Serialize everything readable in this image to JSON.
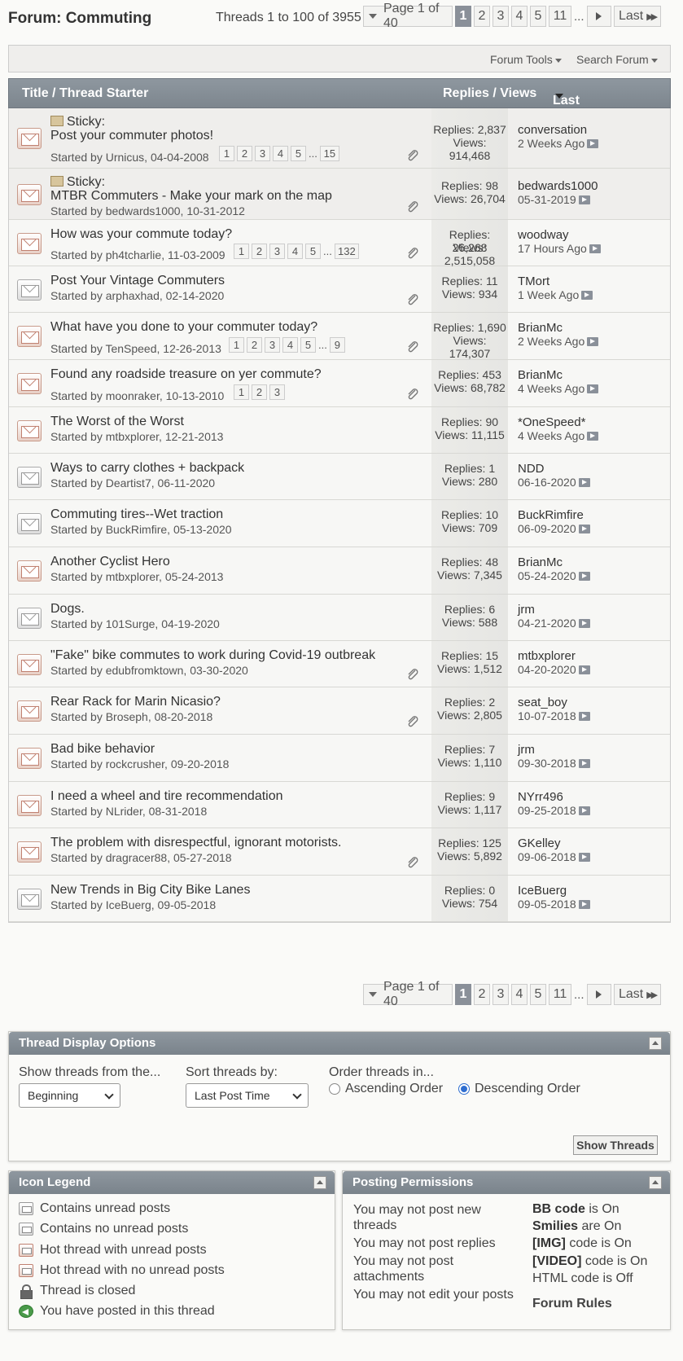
{
  "forum_title": "Forum: Commuting",
  "threads_count": "Threads 1 to 100 of 3955",
  "pager": {
    "page_label": "Page 1 of 40",
    "pages": [
      "1",
      "2",
      "3",
      "4",
      "5",
      "11"
    ],
    "ellipsis": "...",
    "last_label": "Last"
  },
  "toolbar": {
    "forum_tools": "Forum Tools",
    "search_forum": "Search Forum"
  },
  "table_header": {
    "title": "Title / Thread Starter",
    "replies_views": "Replies / Views",
    "last_post": "Last Post By"
  },
  "threads": [
    {
      "sticky": "Sticky:",
      "title": "Post your commuter photos!",
      "starter": "Started by Urnicus, 04-04-2008",
      "pages": [
        "1",
        "2",
        "3",
        "4",
        "5"
      ],
      "last_page": "15",
      "replies": "Replies: 2,837",
      "views": "Views: 914,468",
      "last_user": "conversation",
      "last_date": "2 Weeks Ago",
      "attach": true,
      "hot": true
    },
    {
      "sticky": "Sticky:",
      "title": "MTBR Commuters - Make your mark on the map",
      "starter": "Started by bedwards1000, 10-31-2012",
      "pages": [],
      "last_page": "",
      "replies": "Replies: 98",
      "views": "Views: 26,704",
      "last_user": "bedwards1000",
      "last_date": "05-31-2019",
      "attach": true,
      "hot": true
    },
    {
      "sticky": "",
      "title": "How was your commute today?",
      "starter": "Started by ph4tcharlie, 11-03-2009",
      "pages": [
        "1",
        "2",
        "3",
        "4",
        "5"
      ],
      "last_page": "132",
      "replies": "Replies: 26,268",
      "views": "Views: 2,515,058",
      "last_user": "woodway",
      "last_date": "17 Hours Ago",
      "attach": true,
      "hot": true
    },
    {
      "sticky": "",
      "title": "Post Your Vintage Commuters",
      "starter": "Started by arphaxhad, 02-14-2020",
      "pages": [],
      "last_page": "",
      "replies": "Replies: 11",
      "views": "Views: 934",
      "last_user": "TMort",
      "last_date": "1 Week Ago",
      "attach": true,
      "hot": false
    },
    {
      "sticky": "",
      "title": "What have you done to your commuter today?",
      "starter": "Started by TenSpeed, 12-26-2013",
      "pages": [
        "1",
        "2",
        "3",
        "4",
        "5"
      ],
      "last_page": "9",
      "replies": "Replies: 1,690",
      "views": "Views: 174,307",
      "last_user": "BrianMc",
      "last_date": "2 Weeks Ago",
      "attach": true,
      "hot": true
    },
    {
      "sticky": "",
      "title": "Found any roadside treasure on yer commute?",
      "starter": "Started by moonraker, 10-13-2010",
      "pages": [
        "1",
        "2",
        "3"
      ],
      "last_page": "",
      "replies": "Replies: 453",
      "views": "Views: 68,782",
      "last_user": "BrianMc",
      "last_date": "4 Weeks Ago",
      "attach": true,
      "hot": true
    },
    {
      "sticky": "",
      "title": "The Worst of the Worst",
      "starter": "Started by mtbxplorer, 12-21-2013",
      "pages": [],
      "last_page": "",
      "replies": "Replies: 90",
      "views": "Views: 11,115",
      "last_user": "*OneSpeed*",
      "last_date": "4 Weeks Ago",
      "attach": false,
      "hot": true
    },
    {
      "sticky": "",
      "title": "Ways to carry clothes + backpack",
      "starter": "Started by Deartist7, 06-11-2020",
      "pages": [],
      "last_page": "",
      "replies": "Replies: 1",
      "views": "Views: 280",
      "last_user": "NDD",
      "last_date": "06-16-2020",
      "attach": false,
      "hot": false
    },
    {
      "sticky": "",
      "title": "Commuting tires--Wet traction",
      "starter": "Started by BuckRimfire, 05-13-2020",
      "pages": [],
      "last_page": "",
      "replies": "Replies: 10",
      "views": "Views: 709",
      "last_user": "BuckRimfire",
      "last_date": "06-09-2020",
      "attach": false,
      "hot": false
    },
    {
      "sticky": "",
      "title": "Another Cyclist Hero",
      "starter": "Started by mtbxplorer, 05-24-2013",
      "pages": [],
      "last_page": "",
      "replies": "Replies: 48",
      "views": "Views: 7,345",
      "last_user": "BrianMc",
      "last_date": "05-24-2020",
      "attach": false,
      "hot": true
    },
    {
      "sticky": "",
      "title": "Dogs.",
      "starter": "Started by 101Surge, 04-19-2020",
      "pages": [],
      "last_page": "",
      "replies": "Replies: 6",
      "views": "Views: 588",
      "last_user": "jrm",
      "last_date": "04-21-2020",
      "attach": false,
      "hot": false
    },
    {
      "sticky": "",
      "title": "\"Fake\" bike commutes to work during Covid-19 outbreak",
      "starter": "Started by edubfromktown, 03-30-2020",
      "pages": [],
      "last_page": "",
      "replies": "Replies: 15",
      "views": "Views: 1,512",
      "last_user": "mtbxplorer",
      "last_date": "04-20-2020",
      "attach": true,
      "hot": true
    },
    {
      "sticky": "",
      "title": "Rear Rack for Marin Nicasio?",
      "starter": "Started by Broseph, 08-20-2018",
      "pages": [],
      "last_page": "",
      "replies": "Replies: 2",
      "views": "Views: 2,805",
      "last_user": "seat_boy",
      "last_date": "10-07-2018",
      "attach": true,
      "hot": true
    },
    {
      "sticky": "",
      "title": "Bad bike behavior",
      "starter": "Started by rockcrusher, 09-20-2018",
      "pages": [],
      "last_page": "",
      "replies": "Replies: 7",
      "views": "Views: 1,110",
      "last_user": "jrm",
      "last_date": "09-30-2018",
      "attach": false,
      "hot": true
    },
    {
      "sticky": "",
      "title": "I need a wheel and tire recommendation",
      "starter": "Started by NLrider, 08-31-2018",
      "pages": [],
      "last_page": "",
      "replies": "Replies: 9",
      "views": "Views: 1,117",
      "last_user": "NYrr496",
      "last_date": "09-25-2018",
      "attach": false,
      "hot": true
    },
    {
      "sticky": "",
      "title": "The problem with disrespectful, ignorant motorists.",
      "starter": "Started by dragracer88, 05-27-2018",
      "pages": [],
      "last_page": "",
      "replies": "Replies: 125",
      "views": "Views: 5,892",
      "last_user": "GKelley",
      "last_date": "09-06-2018",
      "attach": true,
      "hot": true
    },
    {
      "sticky": "",
      "title": "New Trends in Big City Bike Lanes",
      "starter": "Started by IceBuerg, 09-05-2018",
      "pages": [],
      "last_page": "",
      "replies": "Replies: 0",
      "views": "Views: 754",
      "last_user": "IceBuerg",
      "last_date": "09-05-2018",
      "attach": false,
      "hot": false
    }
  ],
  "display_options": {
    "title": "Thread Display Options",
    "show_from_label": "Show threads from the...",
    "show_from_value": "Beginning",
    "sort_label": "Sort threads by:",
    "sort_value": "Last Post Time",
    "order_label": "Order threads in...",
    "ascending": "Ascending Order",
    "descending": "Descending Order",
    "show_button": "Show Threads"
  },
  "legend": {
    "title": "Icon Legend",
    "items": [
      "Contains unread posts",
      "Contains no unread posts",
      "Hot thread with unread posts",
      "Hot thread with no unread posts",
      "Thread is closed",
      "You have posted in this thread"
    ]
  },
  "permissions": {
    "title": "Posting Permissions",
    "lines": [
      "You may not post new threads",
      "You may not post replies",
      "You may not post attachments",
      "You may not edit your posts"
    ],
    "bb_code_key": "BB code",
    "bb_code_val": "is On",
    "smilies_key": "Smilies",
    "smilies_val": "are On",
    "img_key": "[IMG]",
    "img_val": "code is On",
    "video_key": "[VIDEO]",
    "video_val": "code is On",
    "html_line": "HTML code is Off",
    "forum_rules": "Forum Rules"
  }
}
